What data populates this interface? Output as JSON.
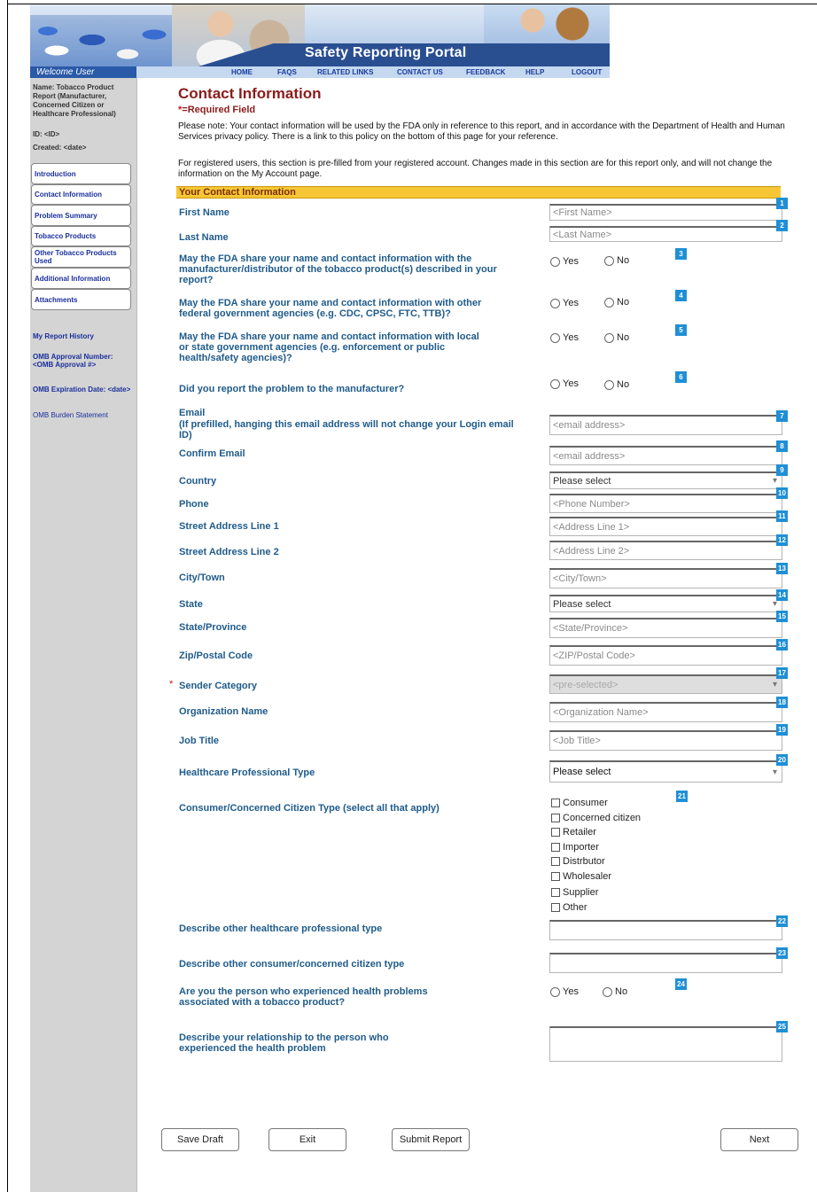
{
  "header": {
    "portal_title": "Safety Reporting Portal",
    "welcome": "Welcome User",
    "nav": [
      "HOME",
      "FAQS",
      "RELATED LINKS",
      "CONTACT US",
      "FEEDBACK",
      "HELP",
      "LOGOUT"
    ]
  },
  "sidebar": {
    "report_name": "Name: Tobacco Product Report (Manufacturer, Concerned Citizen or Healthcare Professional)",
    "id": "ID: <ID>",
    "created": "Created: <date>",
    "items": [
      "Introduction",
      "Contact Information",
      "Problem Summary",
      "Tobacco Products",
      "Other Tobacco Products Used",
      "Additional Information",
      "Attachments"
    ],
    "report_history": "My Report History",
    "omb_number": "OMB Approval Number: <OMB Approval #>",
    "omb_expiration": "OMB Expiration Date: <date>",
    "omb_burden": "OMB Burden Statement"
  },
  "main": {
    "title": "Contact Information",
    "required_star": "*",
    "required_text": "=Required Field",
    "note": "Please note: Your contact information will be used by the FDA only in reference to this report, and in accordance with the Department of Health and Human Services privacy policy. There is a link to this policy on the bottom of this page for your reference.",
    "registered_note": "For registered users, this section is pre-filled from your registered account. Changes made in this section are for this report only, and will not change the information on the My Account page.",
    "section_title": "Your Contact Information",
    "yes": "Yes",
    "no": "No",
    "labels": {
      "first_name": "First Name",
      "last_name": "Last Name",
      "share_manufacturer": "May the FDA share your name and contact information with the manufacturer/distributor of the tobacco product(s) described in your report?",
      "share_federal": "May the FDA share your name and contact information with other federal government agencies (e.g. CDC, CPSC, FTC, TTB)?",
      "share_local": "May the FDA share your name and contact information with local or state government agencies (e.g. enforcement or public health/safety agencies)?",
      "reported_manufacturer": "Did you report the problem to the manufacturer?",
      "email": "Email",
      "email_note": "(If prefilled, hanging this email address will not change your Login email ID)",
      "confirm_email": "Confirm Email",
      "country": "Country",
      "phone": "Phone",
      "street1": "Street Address Line 1",
      "street2": "Street Address Line 2",
      "city": "City/Town",
      "state": "State",
      "state_province": "State/Province",
      "zip": "Zip/Postal Code",
      "sender_star": "*",
      "sender_category": "Sender Category",
      "organization": "Organization Name",
      "job_title": "Job Title",
      "hcp_type": "Healthcare Professional Type",
      "consumer_type": "Consumer/Concerned Citizen Type (select all that apply)",
      "other_hcp": "Describe other healthcare professional type",
      "other_consumer": "Describe other consumer/concerned citizen type",
      "experienced": "Are you the person who experienced health problems associated with a tobacco product?",
      "relationship": "Describe your relationship to the person who experienced the health problem"
    },
    "placeholders": {
      "first_name": "<First Name>",
      "last_name": "<Last Name>",
      "email": "<email address>",
      "confirm_email": "<email address>",
      "country": "Please select",
      "phone": "<Phone Number>",
      "street1": "<Address Line 1>",
      "street2": "<Address Line 2>",
      "city": "<City/Town>",
      "state": "Please select",
      "state_province": "<State/Province>",
      "zip": "<ZIP/Postal Code>",
      "sender_category": "<pre-selected>",
      "organization": "<Organization Name>",
      "job_title": "<Job Title>",
      "hcp_type": "Please select"
    },
    "consumer_options": [
      "Consumer",
      "Concerned citizen",
      "Retailer",
      "Importer",
      "Distrbutor",
      "Wholesaler",
      "Supplier",
      "Other"
    ],
    "badges": [
      "1",
      "2",
      "3",
      "4",
      "5",
      "6",
      "7",
      "8",
      "9",
      "10",
      "11",
      "12",
      "13",
      "14",
      "15",
      "16",
      "17",
      "18",
      "19",
      "20",
      "21",
      "22",
      "23",
      "24",
      "25"
    ]
  },
  "buttons": {
    "save_draft": "Save Draft",
    "exit": "Exit",
    "submit": "Submit Report",
    "next": "Next"
  },
  "colors": {
    "title_red": "#8b1b1b",
    "label_blue": "#1f5b8a",
    "section_yellow": "#f6c634",
    "badge_blue": "#1f8fd6",
    "sidebar_gray": "#d4d4d4"
  }
}
